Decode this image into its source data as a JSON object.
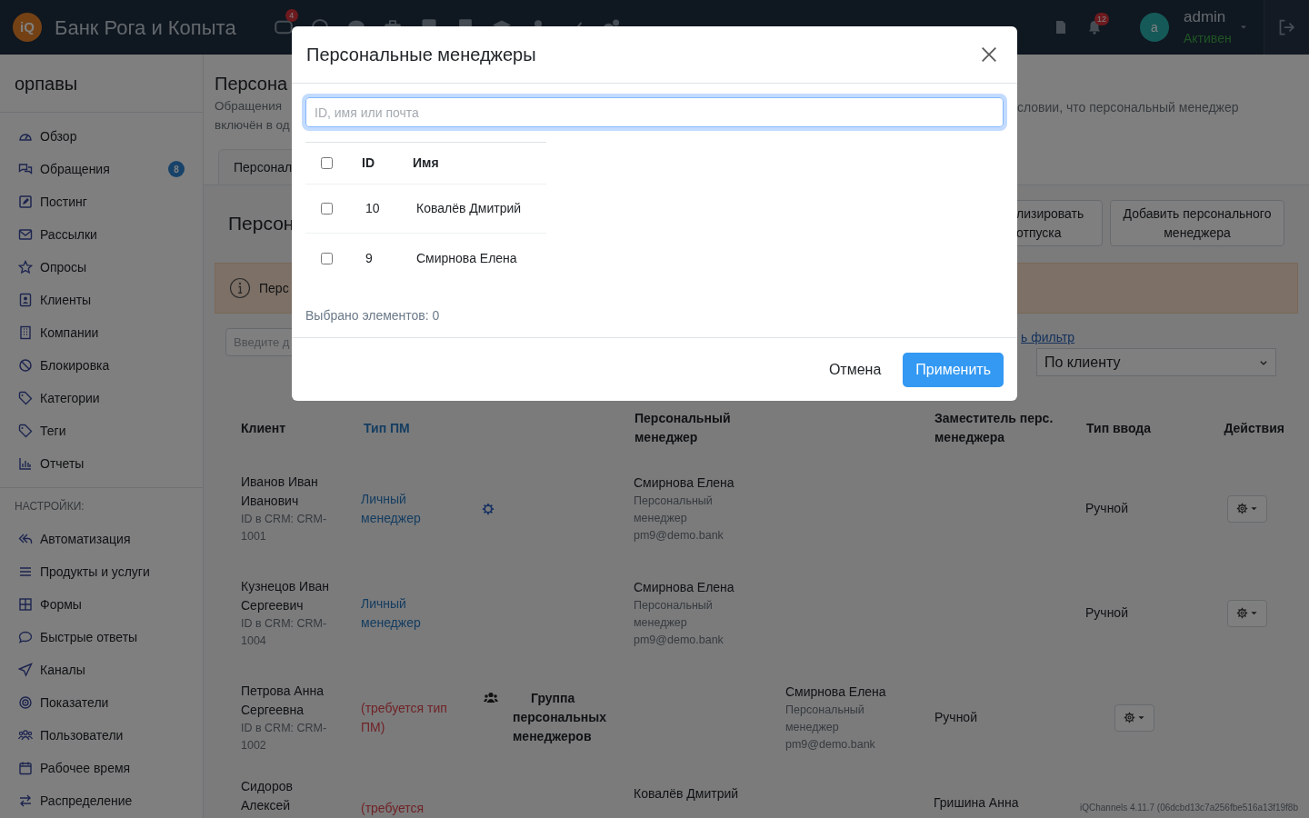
{
  "header": {
    "logo": "iQ",
    "title": "Банк Рога и Копыта",
    "nav_badge": "4",
    "notifications_badge": "12",
    "user": {
      "avatar": "a",
      "name": "admin",
      "status": "Активен"
    }
  },
  "sidebar": {
    "title": "орпавы",
    "items": [
      {
        "label": "Обзор"
      },
      {
        "label": "Обращения",
        "badge": "8"
      },
      {
        "label": "Постинг"
      },
      {
        "label": "Рассылки"
      },
      {
        "label": "Опросы"
      },
      {
        "label": "Клиенты"
      },
      {
        "label": "Компании"
      },
      {
        "label": "Блокировка"
      },
      {
        "label": "Категории"
      },
      {
        "label": "Теги"
      },
      {
        "label": "Отчеты"
      }
    ],
    "section_label": "НАСТРОЙКИ:",
    "settings_items": [
      {
        "label": "Автоматизация"
      },
      {
        "label": "Продукты и услуги"
      },
      {
        "label": "Формы"
      },
      {
        "label": "Быстрые ответы"
      },
      {
        "label": "Каналы"
      },
      {
        "label": "Показатели"
      },
      {
        "label": "Пользователи"
      },
      {
        "label": "Рабочее время"
      },
      {
        "label": "Распределение"
      }
    ]
  },
  "page": {
    "title": "Персона",
    "description_left": [
      "Обращения",
      "включён в од"
    ],
    "description_right": "словии, что персональный менеджер",
    "tab": "Персонал",
    "section_title": "Персон",
    "buttons": [
      {
        "lines": [
          "лизировать",
          "отпуска"
        ]
      },
      {
        "lines": [
          "Добавить персонального",
          "менеджера"
        ]
      }
    ],
    "alert": "Перс",
    "filter_placeholder": "Введите д",
    "filter_link": "ь фильтр",
    "sort_select": "По клиенту"
  },
  "table": {
    "columns": [
      {
        "label": "Клиент",
        "kind": "text"
      },
      {
        "label": "Тип ПМ",
        "kind": "link"
      },
      {
        "label": "Персональный менеджер",
        "kind": "text"
      },
      {
        "label": "Заместитель перс. менеджера",
        "kind": "text"
      },
      {
        "label": "Тип ввода",
        "kind": "text"
      },
      {
        "label": "Действия",
        "kind": "text"
      }
    ],
    "rows": [
      {
        "kind": "personal",
        "client": "Иванов Иван Иванович",
        "crm": "ID в CRM: CRM-1001",
        "pm_type": "Личный менеджер",
        "required": false,
        "settings_icon": true,
        "manager": {
          "name": "Смирнова Елена",
          "role": "Персональный менеджер",
          "email": "pm9@demo.bank"
        },
        "input_type": "Ручной",
        "actions_menu": true
      },
      {
        "kind": "personal",
        "client": "Кузнецов Иван Сергеевич",
        "crm": "ID в CRM: CRM-1004",
        "pm_type": "Личный менеджер",
        "required": false,
        "settings_icon": false,
        "manager": {
          "name": "Смирнова Елена",
          "role": "Персональный менеджер",
          "email": "pm9@demo.bank"
        },
        "input_type": "Ручной",
        "actions_menu": true
      },
      {
        "kind": "group",
        "client": "Петрова Анна Сергеевна",
        "crm": "ID в CRM: CRM-1002",
        "pm_type": "(требуется тип ПМ)",
        "required": true,
        "group": "Группа персональных менеджеров",
        "manager": {
          "name": "Смирнова Елена",
          "role": "Персональный менеджер",
          "email": "pm9@demo.bank"
        },
        "input_type": "Ручной",
        "actions_menu": true
      },
      {
        "kind": "personal",
        "client": "Сидоров Алексей",
        "pm_type": "(требуется",
        "required": true,
        "settings_icon": false,
        "manager": {
          "name": "Ковалёв Дмитрий"
        },
        "deputy": {
          "name": "Гришина Анна"
        },
        "actions_menu": false
      }
    ]
  },
  "version": "iQChannels 4.11.7 (06dcbd13c7a256fbe516a13f19f8b",
  "modal": {
    "title": "Персональные менеджеры",
    "search_placeholder": "ID, имя или почта",
    "select_all": false,
    "columns": [
      "ID",
      "Имя"
    ],
    "rows": [
      {
        "id": "10",
        "name": "Ковалёв Дмитрий",
        "checked": false
      },
      {
        "id": "9",
        "name": "Смирнова Елена",
        "checked": false
      }
    ],
    "selected_count": "Выбрано элементов: 0",
    "cancel": "Отмена",
    "apply": "Применить"
  }
}
